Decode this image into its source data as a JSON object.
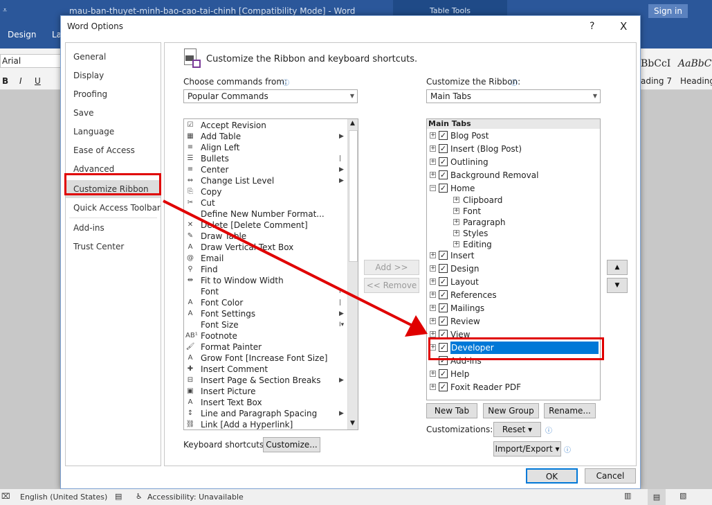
{
  "app": {
    "title": "mau-ban-thuyet-minh-bao-cao-tai-chinh [Compatibility Mode]  -  Word",
    "context_tab": "Table Tools",
    "sign_in": "Sign in",
    "tabs": [
      "Design",
      "La"
    ],
    "font_name": "Arial",
    "format_buttons": [
      "B",
      "I",
      "U"
    ],
    "styles": [
      {
        "preview": "BbCcI",
        "label": "ading 7"
      },
      {
        "preview": "AaBbC",
        "label": "Heading"
      }
    ]
  },
  "dialog": {
    "title": "Word Options",
    "help": "?",
    "close": "X",
    "nav": [
      "General",
      "Display",
      "Proofing",
      "Save",
      "Language",
      "Ease of Access",
      "Advanced",
      "Customize Ribbon",
      "Quick Access Toolbar",
      "Add-ins",
      "Trust Center"
    ],
    "selected_nav": "Customize Ribbon",
    "heading": "Customize the Ribbon and keyboard shortcuts.",
    "choose_label": "Choose commands from:",
    "choose_value": "Popular Commands",
    "ribbon_label": "Customize the Ribbon:",
    "ribbon_value": "Main Tabs",
    "commands": [
      {
        "label": "Accept Revision",
        "icon": "accept-revision-icon",
        "g": "☑"
      },
      {
        "label": "Add Table",
        "icon": "table-icon",
        "g": "▦",
        "sub": "▶"
      },
      {
        "label": "Align Left",
        "icon": "align-left-icon",
        "g": "≡"
      },
      {
        "label": "Bullets",
        "icon": "bullets-icon",
        "g": "☰",
        "sub": "|▶"
      },
      {
        "label": "Center",
        "icon": "center-icon",
        "g": "≡"
      },
      {
        "label": "Change List Level",
        "icon": "list-level-icon",
        "g": "⇔",
        "sub": "▶"
      },
      {
        "label": "Copy",
        "icon": "copy-icon",
        "g": "⎘"
      },
      {
        "label": "Cut",
        "icon": "scissors-icon",
        "g": "✂"
      },
      {
        "label": "Define New Number Format...",
        "icon": "",
        "g": ""
      },
      {
        "label": "Delete [Delete Comment]",
        "icon": "delete-comment-icon",
        "g": "✕"
      },
      {
        "label": "Draw Table",
        "icon": "draw-table-icon",
        "g": "✎"
      },
      {
        "label": "Draw Vertical Text Box",
        "icon": "vertical-textbox-icon",
        "g": "A"
      },
      {
        "label": "Email",
        "icon": "email-icon",
        "g": "@"
      },
      {
        "label": "Find",
        "icon": "search-icon",
        "g": "⚲"
      },
      {
        "label": "Fit to Window Width",
        "icon": "fit-width-icon",
        "g": "⇹"
      },
      {
        "label": "Font",
        "icon": "",
        "g": "",
        "sub": "I"
      },
      {
        "label": "Font Color",
        "icon": "font-color-icon",
        "g": "A",
        "sub": "|▶"
      },
      {
        "label": "Font Settings",
        "icon": "font-settings-icon",
        "g": "A"
      },
      {
        "label": "Font Size",
        "icon": "",
        "g": "",
        "sub": "I▾"
      },
      {
        "label": "Footnote",
        "icon": "footnote-icon",
        "g": "AB¹"
      },
      {
        "label": "Format Painter",
        "icon": "format-painter-icon",
        "g": "🖌"
      },
      {
        "label": "Grow Font [Increase Font Size]",
        "icon": "grow-font-icon",
        "g": "A"
      },
      {
        "label": "Insert Comment",
        "icon": "comment-icon",
        "g": "✚"
      },
      {
        "label": "Insert Page & Section Breaks",
        "icon": "page-break-icon",
        "g": "⊟",
        "sub": "▶"
      },
      {
        "label": "Insert Picture",
        "icon": "picture-icon",
        "g": "▣"
      },
      {
        "label": "Insert Text Box",
        "icon": "textbox-icon",
        "g": "A"
      },
      {
        "label": "Line and Paragraph Spacing",
        "icon": "line-spacing-icon",
        "g": "↕",
        "sub": "▶"
      },
      {
        "label": "Link [Add a Hyperlink]",
        "icon": "link-icon",
        "g": "⛓"
      }
    ],
    "add_button": "Add >>",
    "remove_button": "<< Remove",
    "tree_header": "Main Tabs",
    "tree": [
      {
        "label": "Blog Post",
        "level": 0,
        "checked": true,
        "expander": "+"
      },
      {
        "label": "Insert (Blog Post)",
        "level": 0,
        "checked": true,
        "expander": "+"
      },
      {
        "label": "Outlining",
        "level": 0,
        "checked": true,
        "expander": "+"
      },
      {
        "label": "Background Removal",
        "level": 0,
        "checked": true,
        "expander": "+"
      },
      {
        "label": "Home",
        "level": 0,
        "checked": true,
        "expander": "−"
      },
      {
        "label": "Clipboard",
        "level": 1,
        "expander": "+"
      },
      {
        "label": "Font",
        "level": 1,
        "expander": "+"
      },
      {
        "label": "Paragraph",
        "level": 1,
        "expander": "+"
      },
      {
        "label": "Styles",
        "level": 1,
        "expander": "+"
      },
      {
        "label": "Editing",
        "level": 1,
        "expander": "+"
      },
      {
        "label": "Insert",
        "level": 0,
        "checked": true,
        "expander": "+"
      },
      {
        "label": "Design",
        "level": 0,
        "checked": true,
        "expander": "+"
      },
      {
        "label": "Layout",
        "level": 0,
        "checked": true,
        "expander": "+"
      },
      {
        "label": "References",
        "level": 0,
        "checked": true,
        "expander": "+"
      },
      {
        "label": "Mailings",
        "level": 0,
        "checked": true,
        "expander": "+"
      },
      {
        "label": "Review",
        "level": 0,
        "checked": true,
        "expander": "+"
      },
      {
        "label": "View",
        "level": 0,
        "checked": true,
        "expander": "+"
      },
      {
        "label": "Developer",
        "level": 0,
        "checked": true,
        "expander": "+",
        "selected": true
      },
      {
        "label": "Add-ins",
        "level": 0,
        "checked": true,
        "expander": ""
      },
      {
        "label": "Help",
        "level": 0,
        "checked": true,
        "expander": "+"
      },
      {
        "label": "Foxit Reader PDF",
        "level": 0,
        "checked": true,
        "expander": "+"
      }
    ],
    "new_tab": "New Tab",
    "new_group": "New Group",
    "rename": "Rename...",
    "customizations_label": "Customizations:",
    "reset": "Reset ▾",
    "import_export": "Import/Export ▾",
    "keyboard_label": "Keyboard shortcuts:",
    "customize_button": "Customize...",
    "ok": "OK",
    "cancel": "Cancel"
  },
  "status": {
    "language": "English (United States)",
    "accessibility": "Accessibility: Unavailable"
  },
  "colors": {
    "word_blue": "#2b579a",
    "selection": "#0078d7",
    "annotation_red": "#e00000"
  }
}
